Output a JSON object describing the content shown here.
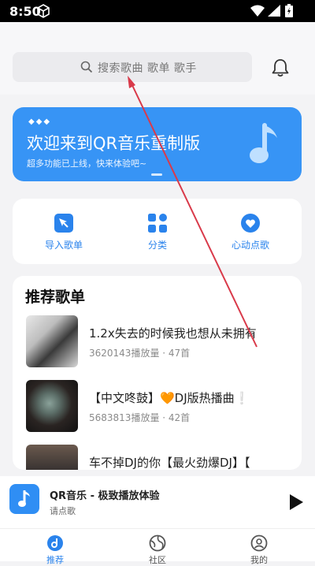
{
  "status_bar": {
    "time": "8:50"
  },
  "search": {
    "placeholder": "搜索歌曲 歌单 歌手"
  },
  "banner": {
    "title": "欢迎来到QR音乐重制版",
    "subtitle": "超多功能已上线，快来体验吧~"
  },
  "quick_actions": [
    {
      "label": "导入歌单",
      "icon": "import-icon"
    },
    {
      "label": "分类",
      "icon": "category-icon"
    },
    {
      "label": "心动点歌",
      "icon": "heart-song-icon"
    }
  ],
  "recommended": {
    "heading": "推荐歌单",
    "playlists": [
      {
        "name": "1.2x失去的时候我也想从未拥有",
        "meta": "3620143播放量 · 47首"
      },
      {
        "name": "【中文咚鼓】🧡DJ版热播曲❕",
        "meta": "5683813播放量 · 42首"
      },
      {
        "name": "车不掉DJ的你【最火劲爆DJ】【",
        "meta": ""
      }
    ]
  },
  "player": {
    "title": "QR音乐 - 极致播放体验",
    "subtitle": "请点歌"
  },
  "tabs": [
    {
      "label": "推荐",
      "active": true
    },
    {
      "label": "社区",
      "active": false
    },
    {
      "label": "我的",
      "active": false
    }
  ],
  "colors": {
    "accent": "#3794f5",
    "annotation": "#d93a4a"
  }
}
